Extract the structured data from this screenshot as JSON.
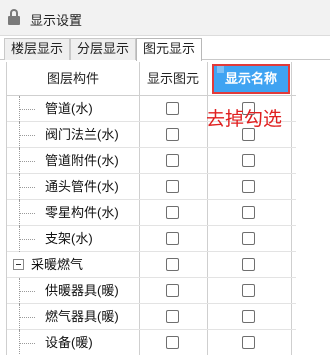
{
  "window": {
    "title": "显示设置"
  },
  "tabs": [
    {
      "label": "楼层显示",
      "active": false
    },
    {
      "label": "分层显示",
      "active": false
    },
    {
      "label": "图元显示",
      "active": true
    }
  ],
  "columns": {
    "component": "图层构件",
    "show_element": "显示图元",
    "show_name": "显示名称"
  },
  "rows": [
    {
      "label": "管道(水)",
      "type": "child",
      "show_element": false,
      "show_name": false
    },
    {
      "label": "阀门法兰(水)",
      "type": "child",
      "show_element": false,
      "show_name": false
    },
    {
      "label": "管道附件(水)",
      "type": "child",
      "show_element": false,
      "show_name": false
    },
    {
      "label": "通头管件(水)",
      "type": "child",
      "show_element": false,
      "show_name": false
    },
    {
      "label": "零星构件(水)",
      "type": "child",
      "show_element": false,
      "show_name": false
    },
    {
      "label": "支架(水)",
      "type": "child",
      "show_element": false,
      "show_name": false
    },
    {
      "label": "采暖燃气",
      "type": "group",
      "expanded": true,
      "show_element": false,
      "show_name": false
    },
    {
      "label": "供暖器具(暖)",
      "type": "child",
      "show_element": false,
      "show_name": false
    },
    {
      "label": "燃气器具(暖)",
      "type": "child",
      "show_element": false,
      "show_name": false
    },
    {
      "label": "设备(暖)",
      "type": "child",
      "show_element": false,
      "show_name": false
    }
  ],
  "annotation": {
    "text": "去掉勾选"
  },
  "colors": {
    "header_highlight": "#3fa3f2",
    "annotation_red": "#e02020"
  }
}
